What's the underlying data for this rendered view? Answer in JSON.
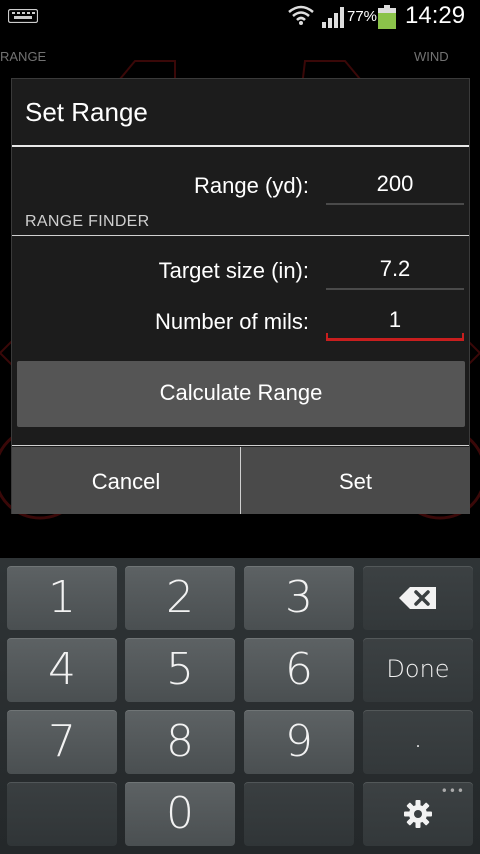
{
  "status_bar": {
    "battery_percent": "77%",
    "time": "14:29",
    "icons": [
      "keyboard-icon",
      "wifi-icon",
      "signal-icon",
      "battery-icon"
    ]
  },
  "background_app": {
    "range_label": "RANGE",
    "wind_label": "WIND"
  },
  "dialog": {
    "title": "Set Range",
    "range_label": "Range (yd):",
    "range_value": "200",
    "section_header": "RANGE FINDER",
    "target_label": "Target size (in):",
    "target_value": "7.2",
    "mils_label": "Number of mils:",
    "mils_value": "1",
    "calculate_label": "Calculate Range",
    "cancel_label": "Cancel",
    "set_label": "Set"
  },
  "keyboard": {
    "keys": [
      "1",
      "2",
      "3",
      "4",
      "5",
      "6",
      "7",
      "8",
      "9",
      "0",
      "Done",
      "."
    ],
    "backspace_icon": "backspace-icon",
    "settings_icon": "gear-icon",
    "more_indicator": "•••"
  },
  "colors": {
    "accent_red": "#c81e1e",
    "dialog_bg": "#1c1c1c",
    "button_bg": "#555555"
  }
}
